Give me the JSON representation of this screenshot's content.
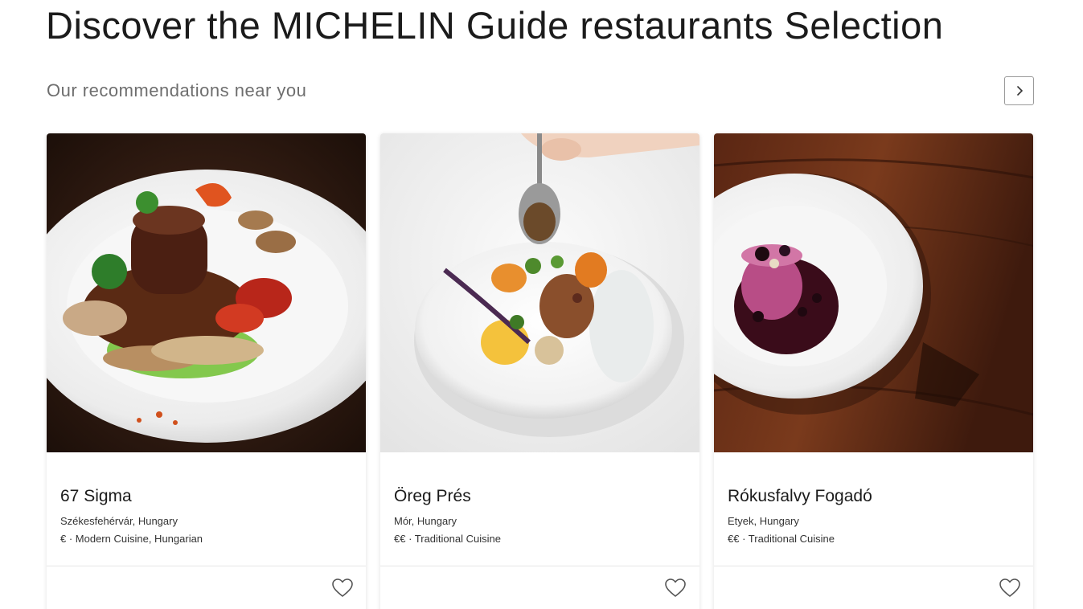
{
  "header": {
    "title": "Discover the MICHELIN Guide restaurants Selection",
    "subtitle": "Our recommendations near you",
    "next_icon": "chevron-right-icon"
  },
  "restaurants": [
    {
      "name": "67 Sigma",
      "location": "Székesfehérvár, Hungary",
      "meta": "€ · Modern Cuisine, Hungarian",
      "image": "plated steak with mushrooms and peppers",
      "favorite_icon": "heart-outline-icon"
    },
    {
      "name": "Öreg Prés",
      "location": "Mór, Hungary",
      "meta": "€€ · Traditional Cuisine",
      "image": "plated meat with vegetables and spoon of sauce",
      "favorite_icon": "heart-outline-icon"
    },
    {
      "name": "Rókusfalvy Fogadó",
      "location": "Etyek, Hungary",
      "meta": "€€ · Traditional Cuisine",
      "image": "berry dessert on white plate, wooden table",
      "favorite_icon": "heart-outline-icon"
    }
  ],
  "colors": {
    "title": "#1b1b1b",
    "subtitle": "#6e6e6e",
    "border": "#9a9a9a",
    "divider": "#e6e6e6"
  }
}
